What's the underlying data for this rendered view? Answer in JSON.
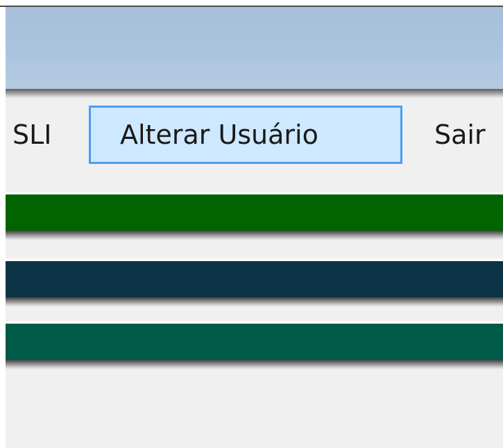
{
  "menu": {
    "items": [
      {
        "label": "SLI"
      },
      {
        "label": "Alterar Usuário",
        "highlighted": true
      },
      {
        "label": "Sair"
      }
    ]
  },
  "bands": [
    {
      "name": "green-band",
      "color": "#006400"
    },
    {
      "name": "navy-band",
      "color": "#0d3346"
    },
    {
      "name": "teal-band",
      "color": "#005a48"
    }
  ],
  "colors": {
    "title_bar": "#a9c3dd",
    "menu_highlight_fill": "#cde8ff",
    "menu_highlight_border": "#4a9ef0",
    "background": "#f0f0f0"
  }
}
